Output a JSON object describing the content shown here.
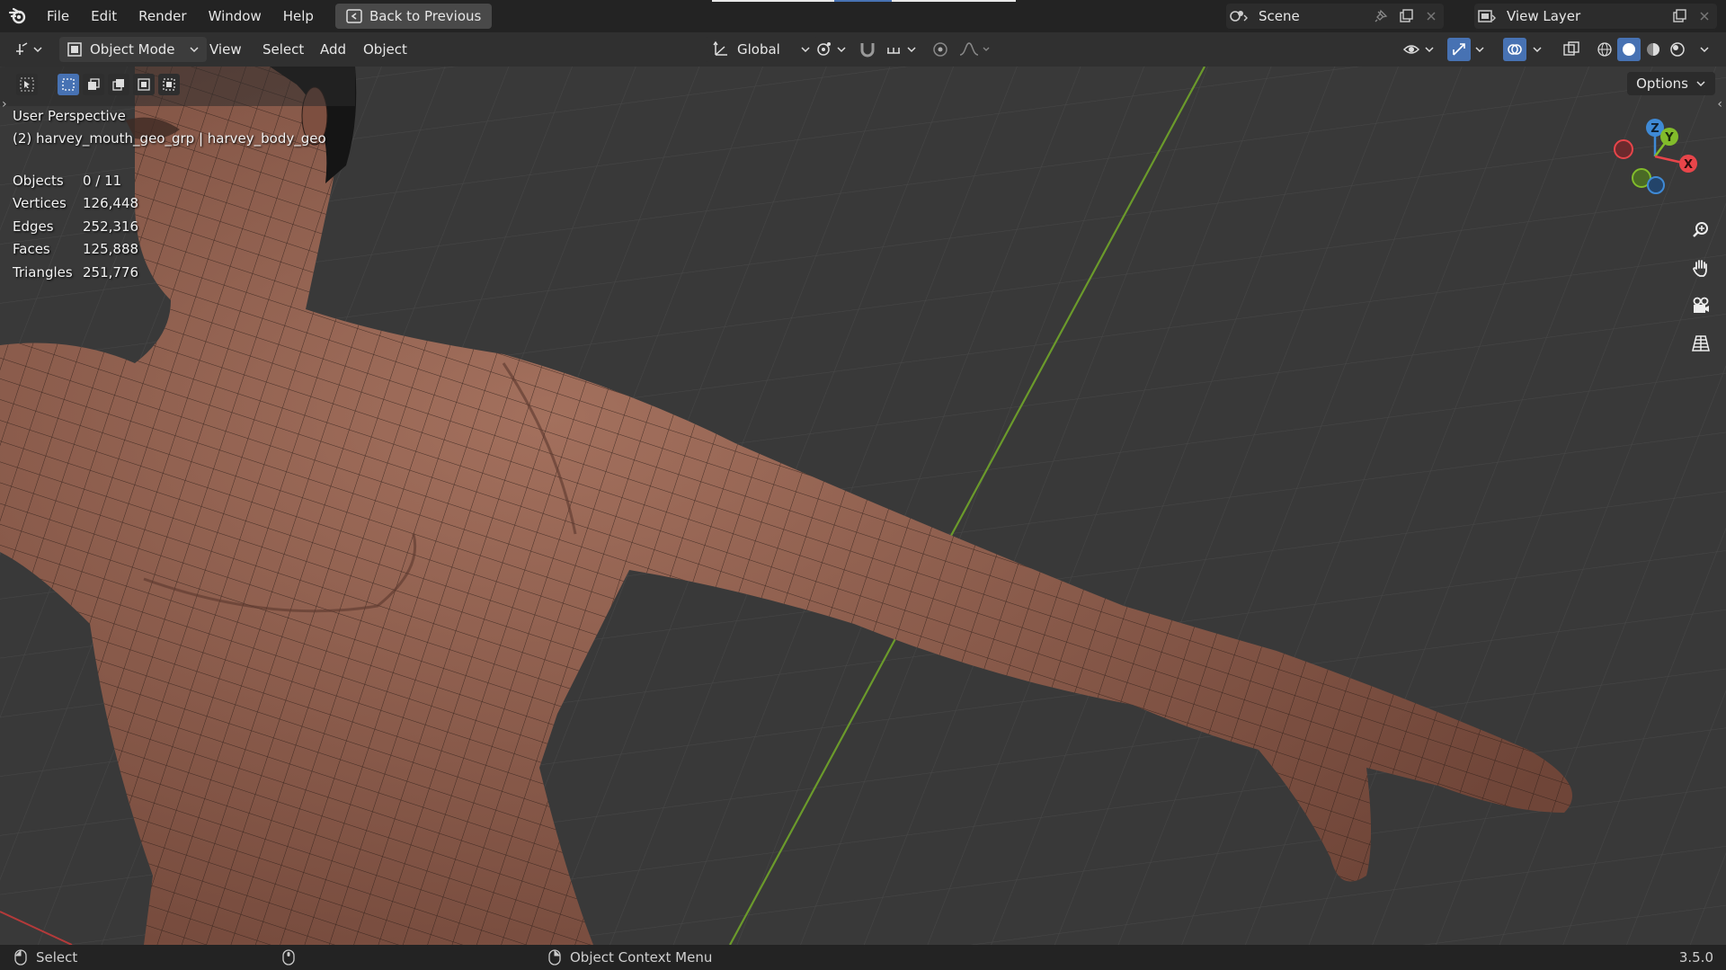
{
  "menubar": {
    "items": [
      "File",
      "Edit",
      "Render",
      "Window",
      "Help"
    ],
    "back_button": "Back to Previous",
    "scene_label": "Scene",
    "view_layer_label": "View Layer"
  },
  "header": {
    "mode": "Object Mode",
    "menus": [
      "View",
      "Select",
      "Add",
      "Object"
    ],
    "transform_orientation": "Global"
  },
  "viewport": {
    "perspective_label": "User Perspective",
    "object_label": "(2) harvey_mouth_geo_grp | harvey_body_geo",
    "options_label": "Options",
    "stats": [
      {
        "label": "Objects",
        "value": "0 / 11"
      },
      {
        "label": "Vertices",
        "value": "126,448"
      },
      {
        "label": "Edges",
        "value": "252,316"
      },
      {
        "label": "Faces",
        "value": "125,888"
      },
      {
        "label": "Triangles",
        "value": "251,776"
      }
    ],
    "gizmo_axes": {
      "x": "X",
      "y": "Y",
      "z": "Z"
    }
  },
  "statusbar": {
    "select": "Select",
    "context_menu": "Object Context Menu",
    "version": "3.5.0"
  },
  "colors": {
    "accent": "#4772b3",
    "axis_x": "#e8454a",
    "axis_y": "#82bc2b",
    "axis_z": "#3f8ad6",
    "skin": "#8f5d4c"
  }
}
